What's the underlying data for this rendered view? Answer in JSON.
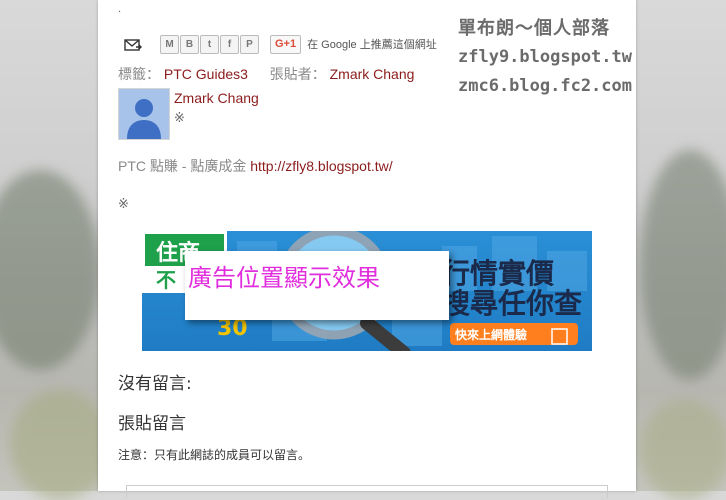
{
  "watermark": {
    "title": "單布朗～個人部落",
    "line1": "zfly9.blogspot.tw",
    "line2": "zmc6.blog.fc2.com"
  },
  "share": {
    "buttons": [
      "M",
      "B",
      "t",
      "f",
      "P"
    ],
    "gplus_label": "G+1",
    "gplus_text": "在 Google 上推薦這個網址"
  },
  "post_meta": {
    "labels_prefix": "標籤：",
    "label": "PTC Guides3",
    "author_prefix": "張貼者：",
    "author": "Zmark Chang"
  },
  "author_profile": {
    "name": "Zmark Chang",
    "mark": "※"
  },
  "ptc": {
    "text": "PTC 點賺 - 點廣成金 ",
    "link": "http://zfly8.blogspot.tw/"
  },
  "mark2": "※",
  "ad": {
    "overlay_text": "廣告位置顯示效果",
    "banner_left_top": "住商",
    "banner_left_bottom": "不",
    "banner_right_top": "行情實價",
    "banner_right_mid": "搜尋任你查",
    "banner_cta": "快來上網體驗",
    "banner_number": "30"
  },
  "comments": {
    "heading": "沒有留言:",
    "post_heading": "張貼留言",
    "note": "注意：只有此網誌的成員可以留言。"
  },
  "colors": {
    "link": "#8b1c1c",
    "ad_text": "#e12ddd",
    "banner_blue": "#2a8fd6"
  }
}
